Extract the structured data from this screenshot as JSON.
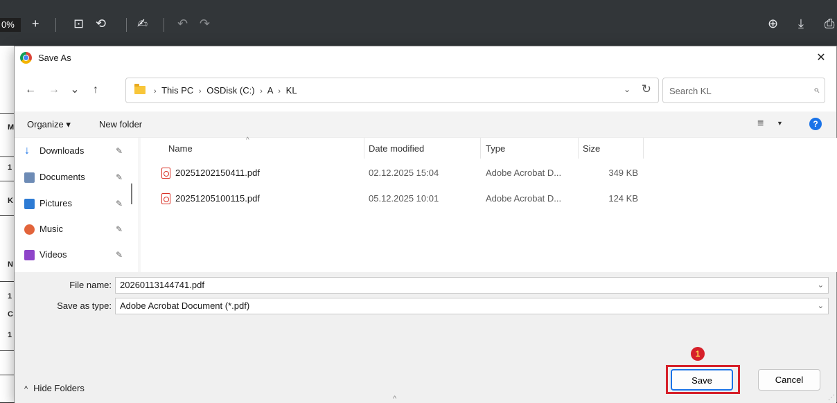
{
  "viewer": {
    "zoom_text": "0%",
    "glyph_plus": "+",
    "glyph_fit": "⊡",
    "glyph_rotate": "⟲",
    "glyph_draw": "✍",
    "glyph_undo": "↶",
    "glyph_redo": "↷",
    "glyph_drive": "⊕",
    "glyph_download": "⤓",
    "glyph_print": "⎙",
    "doc_chars": [
      "M",
      "1",
      "K",
      "N",
      "1",
      "C",
      "1"
    ]
  },
  "dialog": {
    "title": "Save As",
    "close_glyph": "✕",
    "nav": {
      "back": "←",
      "forward": "→",
      "recent": "⌄",
      "up": "↑"
    },
    "breadcrumb": [
      "This PC",
      "OSDisk (C:)",
      "A",
      "KL"
    ],
    "crumb_sep": "›",
    "addr_dropdown": "⌄",
    "refresh_glyph": "↻",
    "search_placeholder": "Search KL",
    "search_glyph": "⌕",
    "toolbar": {
      "organize": "Organize ▾",
      "new_folder": "New folder",
      "view_glyph": "≡",
      "view_dd": "▼",
      "help": "?"
    },
    "sidebar": {
      "pin_glyph": "✎",
      "items": [
        {
          "label": "Downloads",
          "icon": "download-icon",
          "color": "#1a73e8"
        },
        {
          "label": "Documents",
          "icon": "documents-icon",
          "color": "#6d8bb5"
        },
        {
          "label": "Pictures",
          "icon": "pictures-icon",
          "color": "#2d7bd4"
        },
        {
          "label": "Music",
          "icon": "music-icon",
          "color": "#e2643b"
        },
        {
          "label": "Videos",
          "icon": "videos-icon",
          "color": "#8e44c9"
        }
      ]
    },
    "columns": {
      "name": "Name",
      "date": "Date modified",
      "type": "Type",
      "size": "Size",
      "sort_caret": "^"
    },
    "files": [
      {
        "name": "20251202150411.pdf",
        "date": "02.12.2025 15:04",
        "type": "Adobe Acrobat D...",
        "size": "349 KB"
      },
      {
        "name": "20251205100115.pdf",
        "date": "05.12.2025 10:01",
        "type": "Adobe Acrobat D...",
        "size": "124 KB"
      }
    ],
    "form": {
      "file_name_label": "File name:",
      "file_name_value": "20260113144741.pdf",
      "save_type_label": "Save as type:",
      "save_type_value": "Adobe Acrobat Document (*.pdf)",
      "dd_glyph": "⌄"
    },
    "footer": {
      "hide_folders": "Hide Folders",
      "hide_caret": "^",
      "save": "Save",
      "cancel": "Cancel",
      "bottom_caret": "^",
      "grip": "⋰"
    },
    "annotation": {
      "step": "1",
      "color": "#d6202a"
    }
  }
}
